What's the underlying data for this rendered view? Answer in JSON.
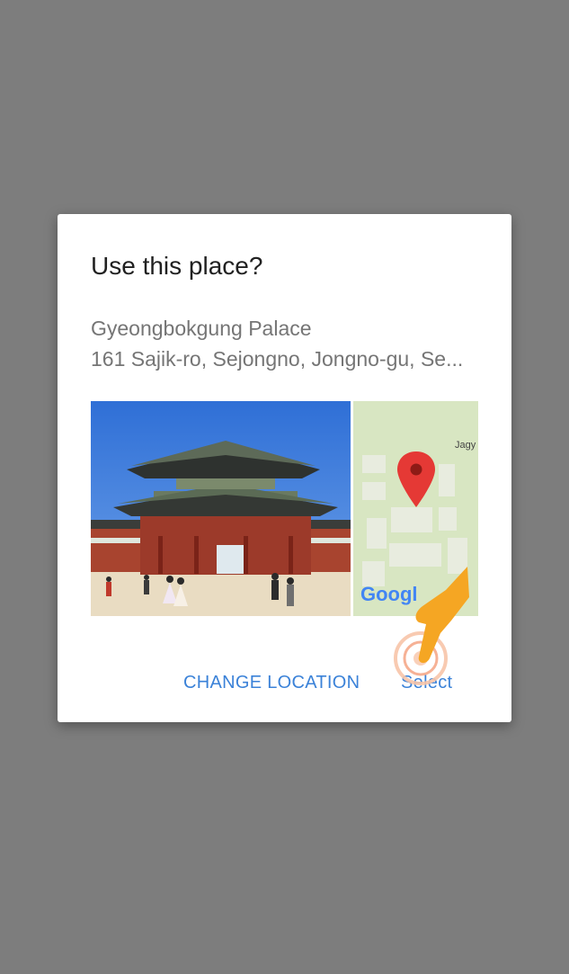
{
  "dialog": {
    "title": "Use this place?",
    "place_name": "Gyeongbokgung Palace",
    "place_address": "161 Sajik-ro, Sejongno, Jongno-gu, Se...",
    "map_label": "Jagy",
    "map_logo": "Googl",
    "buttons": {
      "change_location": "CHANGE LOCATION",
      "select": "Select"
    }
  },
  "colors": {
    "scrim": "#7d7d7d",
    "accent": "#3b82d8",
    "pin": "#e53935",
    "map_bg": "#d8e6c2",
    "hand": "#f5a623"
  },
  "icons": {
    "pin": "map-pin-icon",
    "hand": "tap-hand-icon"
  }
}
